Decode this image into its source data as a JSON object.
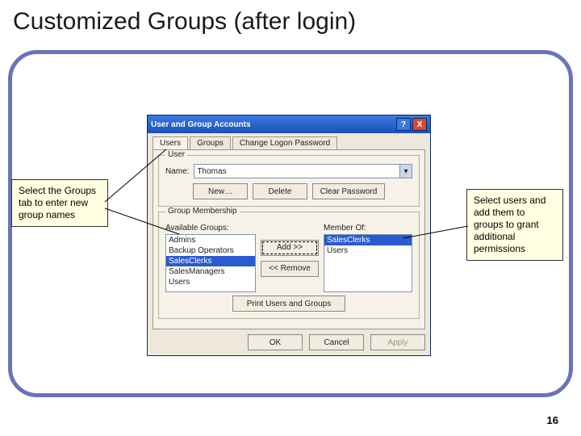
{
  "slide": {
    "title": "Customized Groups (after login)",
    "page_number": "16"
  },
  "callouts": {
    "left": "Select the Groups tab to enter new group names",
    "right": "Select users and add them to groups to grant additional permissions"
  },
  "dialog": {
    "title": "User and Group Accounts",
    "help": "?",
    "close": "X",
    "tabs": {
      "users": "Users",
      "groups": "Groups",
      "pwd": "Change Logon Password"
    },
    "user_section": {
      "legend": "User",
      "name_label": "Name:",
      "name_value": "Thomas",
      "btn_new": "New…",
      "btn_delete": "Delete",
      "btn_clear": "Clear Password"
    },
    "membership": {
      "legend": "Group Membership",
      "available_label": "Available Groups:",
      "memberof_label": "Member Of:",
      "available": {
        "i0": "Admins",
        "i1": "Backup Operators",
        "i2": "SalesClerks",
        "i3": "SalesManagers",
        "i4": "Users"
      },
      "memberof": {
        "i0": "SalesClerks",
        "i1": "Users"
      },
      "btn_add": "Add >>",
      "btn_remove": "<< Remove"
    },
    "btn_print": "Print Users and Groups",
    "footer": {
      "ok": "OK",
      "cancel": "Cancel",
      "apply": "Apply"
    }
  }
}
